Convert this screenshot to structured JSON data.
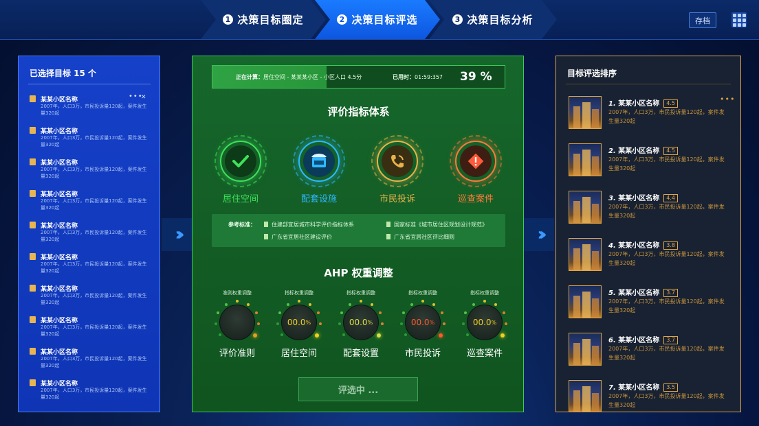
{
  "steps": [
    {
      "num": "1",
      "label": "决策目标圈定"
    },
    {
      "num": "2",
      "label": "决策目标评选"
    },
    {
      "num": "3",
      "label": "决策目标分析"
    }
  ],
  "header": {
    "save_label": "存档",
    "apps_icon": "grid-icon"
  },
  "left": {
    "title": "已选择目标 15 个",
    "items": [
      {
        "name": "某某小区名称",
        "desc": "2007年，人口3万，市民投诉量120起，案件发生量320起"
      },
      {
        "name": "某某小区名称",
        "desc": "2007年，人口3万，市民投诉量120起，案件发生量320起"
      },
      {
        "name": "某某小区名称",
        "desc": "2007年，人口3万，市民投诉量120起，案件发生量320起"
      },
      {
        "name": "某某小区名称",
        "desc": "2007年，人口3万，市民投诉量120起，案件发生量320起"
      },
      {
        "name": "某某小区名称",
        "desc": "2007年，人口3万，市民投诉量120起，案件发生量320起"
      },
      {
        "name": "某某小区名称",
        "desc": "2007年，人口3万，市民投诉量120起，案件发生量320起"
      },
      {
        "name": "某某小区名称",
        "desc": "2007年，人口3万，市民投诉量120起，案件发生量320起"
      },
      {
        "name": "某某小区名称",
        "desc": "2007年，人口3万，市民投诉量120起，案件发生量320起"
      },
      {
        "name": "某某小区名称",
        "desc": "2007年，人口3万，市民投诉量120起，案件发生量320起"
      },
      {
        "name": "某某小区名称",
        "desc": "2007年，人口3万，市民投诉量120起，案件发生量320起"
      }
    ],
    "item_more": "•••",
    "item_close": "✕"
  },
  "progress": {
    "label": "正在计算：",
    "value": "居住空间 - 某某某小区 - 小区人口  4.5分",
    "time_label": "已用时：",
    "time": "01:59:357",
    "percent_text": "39 %",
    "percent": 0.39
  },
  "indicators": {
    "title": "评价指标体系",
    "items": [
      {
        "label": "居住空间",
        "color": "#3fe05a",
        "icon": "check-icon"
      },
      {
        "label": "配套设施",
        "color": "#2fb8ff",
        "icon": "shop-icon"
      },
      {
        "label": "市民投诉",
        "color": "#e9b24a",
        "icon": "phone-icon"
      },
      {
        "label": "巡查案件",
        "color": "#ff7a3a",
        "icon": "alert-icon"
      }
    ]
  },
  "reference": {
    "label": "参考标准：",
    "items": [
      "住建部宜居城市科学评价指标体系",
      "国家标准《城市居住区规划设计规范》",
      "广东省宜居社区建设评价",
      "广东省宜居社区评比细则"
    ]
  },
  "ahp": {
    "title": "AHP 权重调整",
    "dials": [
      {
        "caption": "准则权重调整",
        "value": "",
        "name": "评价准则",
        "color": "#e0a020"
      },
      {
        "caption": "指标权重调整",
        "value": "00.0",
        "name": "居住空间",
        "color": "#f0d020"
      },
      {
        "caption": "指标权重调整",
        "value": "00.0",
        "name": "配套设置",
        "color": "#d8e040"
      },
      {
        "caption": "指标权重调整",
        "value": "00.0",
        "name": "市民投诉",
        "color": "#ff5a2a"
      },
      {
        "caption": "指标权重调整",
        "value": "00.0",
        "name": "巡查案件",
        "color": "#f0d020"
      }
    ],
    "unit": "%",
    "button_label": "评选中 ..."
  },
  "right": {
    "title": "目标评选排序",
    "more": "•••",
    "items": [
      {
        "rank": "1.",
        "name": "某某小区名称",
        "score": "4.5",
        "desc": "2007年，人口3万，市民投诉量120起，案件发生量320起"
      },
      {
        "rank": "2.",
        "name": "某某小区名称",
        "score": "4.5",
        "desc": "2007年，人口3万，市民投诉量120起，案件发生量320起"
      },
      {
        "rank": "3.",
        "name": "某某小区名称",
        "score": "4.4",
        "desc": "2007年，人口3万，市民投诉量120起，案件发生量320起"
      },
      {
        "rank": "4.",
        "name": "某某小区名称",
        "score": "3.8",
        "desc": "2007年，人口3万，市民投诉量120起，案件发生量320起"
      },
      {
        "rank": "5.",
        "name": "某某小区名称",
        "score": "3.7",
        "desc": "2007年，人口3万，市民投诉量120起，案件发生量320起"
      },
      {
        "rank": "6.",
        "name": "某某小区名称",
        "score": "3.7",
        "desc": "2007年，人口3万，市民投诉量120起，案件发生量320起"
      },
      {
        "rank": "7.",
        "name": "某某小区名称",
        "score": "3.5",
        "desc": "2007年，人口3万，市民投诉量120起，案件发生量320起"
      }
    ]
  },
  "colors": {
    "accent_blue": "#1a7bff",
    "panel_green": "#16672c",
    "panel_gold": "#e0a548"
  }
}
